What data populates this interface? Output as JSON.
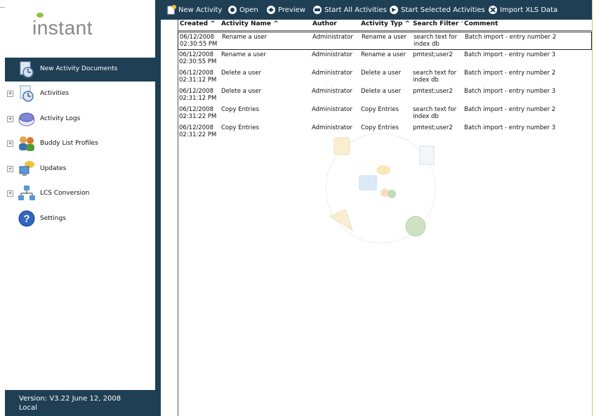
{
  "app": {
    "logo_text": "instant"
  },
  "sidebar": {
    "header_item": {
      "label": "New Activity Documents",
      "icon": "clock-document-icon"
    },
    "items": [
      {
        "label": "Activities",
        "icon": "clock-document-icon",
        "expandable": true
      },
      {
        "label": "Activity Logs",
        "icon": "log-disk-icon",
        "expandable": true
      },
      {
        "label": "Buddy List Profiles",
        "icon": "users-icon",
        "expandable": true
      },
      {
        "label": "Updates",
        "icon": "monitor-chat-icon",
        "expandable": true
      },
      {
        "label": "LCS Conversion",
        "icon": "network-icon",
        "expandable": true
      },
      {
        "label": "Settings",
        "icon": "help-icon",
        "expandable": false
      }
    ],
    "version_line1": "Version: V3.22 June 12, 2008",
    "version_line2": "Local"
  },
  "toolbar": {
    "buttons": [
      {
        "label": "New Activity",
        "icon": "new-document-icon"
      },
      {
        "label": "Open",
        "icon": "open-icon"
      },
      {
        "label": "Preview",
        "icon": "preview-icon"
      },
      {
        "label": "Start All Activities",
        "icon": "start-all-icon"
      },
      {
        "label": "Start Selected Activities",
        "icon": "start-selected-icon"
      },
      {
        "label": "Import XLS Data",
        "icon": "import-icon"
      }
    ]
  },
  "table": {
    "columns": [
      "Created",
      "Activity Name",
      "Author",
      "Activity Typ",
      "Search Filter",
      "Comment"
    ],
    "rows": [
      {
        "date": "06/12/2008",
        "time": "02:30:55 PM",
        "name": "Rename a user",
        "author": "Administrator",
        "type": "Rename a user",
        "filter1": "search text for",
        "filter2": "index db",
        "comment": "Batch import - entry number 2"
      },
      {
        "date": "06/12/2008",
        "time": "02:30:55 PM",
        "name": "Rename a user",
        "author": "Administrator",
        "type": "Rename a user",
        "filter1": "pmtest;user2",
        "filter2": "",
        "comment": "Batch import - entry number 3"
      },
      {
        "date": "06/12/2008",
        "time": "02:31:12 PM",
        "name": "Delete a user",
        "author": "Administrator",
        "type": "Delete a user",
        "filter1": "search text for",
        "filter2": "index db",
        "comment": "Batch import - entry number 2"
      },
      {
        "date": "06/12/2008",
        "time": "02:31:12 PM",
        "name": "Delete a user",
        "author": "Administrator",
        "type": "Delete a user",
        "filter1": "pmtest;user2",
        "filter2": "",
        "comment": "Batch import - entry number 3"
      },
      {
        "date": "06/12/2008",
        "time": "02:31:22 PM",
        "name": "Copy Entries",
        "author": "Administrator",
        "type": "Copy Entries",
        "filter1": "search text for",
        "filter2": "index db",
        "comment": "Batch import - entry number 2"
      },
      {
        "date": "06/12/2008",
        "time": "02:31:22 PM",
        "name": "Copy Entries",
        "author": "Administrator",
        "type": "Copy Entries",
        "filter1": "pmtest;user2",
        "filter2": "",
        "comment": "Batch import - entry number 3"
      }
    ]
  },
  "colors": {
    "navy": "#1f3f55",
    "logo_green": "#8fc23a",
    "logo_gray": "#888888"
  }
}
